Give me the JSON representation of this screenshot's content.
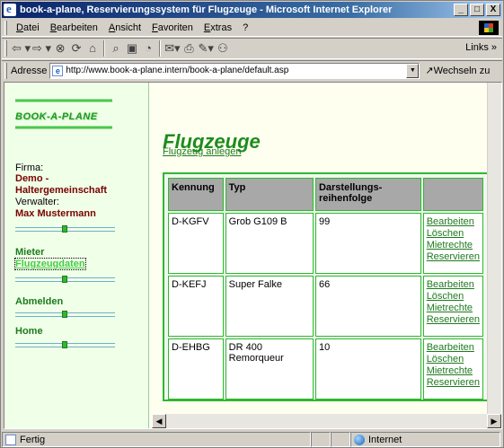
{
  "window": {
    "title": "book-a-plane, Reservierungssystem für Flugzeuge - Microsoft Internet Explorer",
    "buttons": [
      "_",
      "□",
      "X"
    ]
  },
  "menu": [
    "Datei",
    "Bearbeiten",
    "Ansicht",
    "Favoriten",
    "Extras",
    "?"
  ],
  "toolbar": {
    "links_label": "Links »",
    "icons": [
      "back-icon",
      "forward-icon",
      "stop-icon",
      "refresh-icon",
      "home-icon",
      "search-icon",
      "favorites-icon",
      "history-icon",
      "mail-icon",
      "print-icon",
      "edit-icon",
      "discuss-icon"
    ]
  },
  "address": {
    "label": "Adresse",
    "url": "http://www.book-a-plane.intern/book-a-plane/default.asp",
    "go_label": "Wechseln zu"
  },
  "sidebar": {
    "logo": "BOOK-A-PLANE",
    "firma_label": "Firma:",
    "firma_value": "Demo - Haltergemeinschaft",
    "verwalter_label": "Verwalter:",
    "verwalter_value": "Max Mustermann",
    "nav": {
      "mieter": "Mieter",
      "flugzeugdaten": "Flugzeugdaten",
      "abmelden": "Abmelden",
      "home": "Home"
    }
  },
  "main": {
    "title": "Flugzeuge",
    "add_link": "Flugzeug anlegen",
    "columns": [
      "Kennung",
      "Typ",
      "Darstellungs-reihenfolge",
      ""
    ],
    "rows": [
      {
        "kennung": "D-KGFV",
        "typ": "Grob G109 B",
        "reihenfolge": "99"
      },
      {
        "kennung": "D-KEFJ",
        "typ": "Super Falke",
        "reihenfolge": "66"
      },
      {
        "kennung": "D-EHBG",
        "typ": "DR 400 Remorqueur",
        "reihenfolge": "10"
      }
    ],
    "actions": [
      "Bearbeiten",
      "Löschen",
      "Mietrechte",
      "Reservieren"
    ]
  },
  "status": {
    "text": "Fertig",
    "zone": "Internet"
  }
}
